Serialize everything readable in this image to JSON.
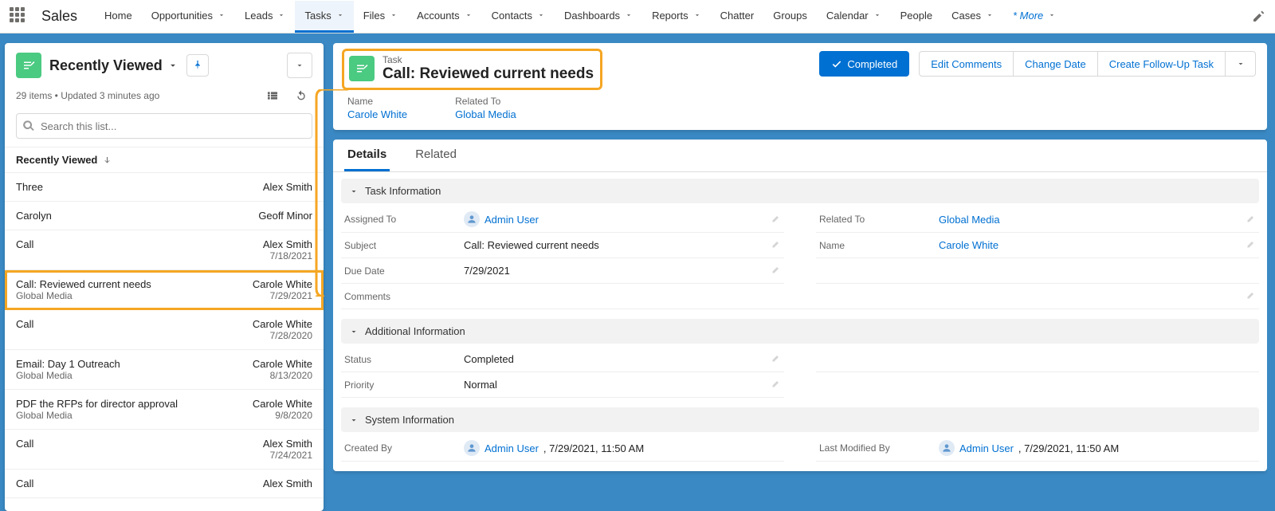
{
  "app": {
    "name": "Sales"
  },
  "nav": {
    "items": [
      "Home",
      "Opportunities",
      "Leads",
      "Tasks",
      "Files",
      "Accounts",
      "Contacts",
      "Dashboards",
      "Reports",
      "Chatter",
      "Groups",
      "Calendar",
      "People",
      "Cases"
    ],
    "more_label": "* More",
    "active": "Tasks",
    "no_caret": [
      "Home",
      "Chatter",
      "Groups",
      "People"
    ]
  },
  "list": {
    "title": "Recently Viewed",
    "meta": "29 items • Updated 3 minutes ago",
    "search_placeholder": "Search this list...",
    "sort_label": "Recently Viewed",
    "rows": [
      {
        "subject": "Three",
        "who": "Alex Smith",
        "related": "",
        "date": ""
      },
      {
        "subject": "Carolyn",
        "who": "Geoff Minor",
        "related": "",
        "date": ""
      },
      {
        "subject": "Call",
        "who": "Alex Smith",
        "related": "",
        "date": "7/18/2021"
      },
      {
        "subject": "Call: Reviewed current needs",
        "who": "Carole White",
        "related": "Global Media",
        "date": "7/29/2021",
        "selected": true
      },
      {
        "subject": "Call",
        "who": "Carole White",
        "related": "",
        "date": "7/28/2020"
      },
      {
        "subject": "Email: Day 1 Outreach",
        "who": "Carole White",
        "related": "Global Media",
        "date": "8/13/2020"
      },
      {
        "subject": "PDF the RFPs for director approval",
        "who": "Carole White",
        "related": "Global Media",
        "date": "9/8/2020"
      },
      {
        "subject": "Call",
        "who": "Alex Smith",
        "related": "",
        "date": "7/24/2021"
      },
      {
        "subject": "Call",
        "who": "Alex Smith",
        "related": "",
        "date": ""
      }
    ]
  },
  "record": {
    "type": "Task",
    "title": "Call: Reviewed current needs",
    "actions": {
      "completed": "Completed",
      "edit_comments": "Edit Comments",
      "change_date": "Change Date",
      "followup": "Create Follow-Up Task"
    },
    "header_fields": {
      "name_label": "Name",
      "name": "Carole White",
      "related_label": "Related To",
      "related": "Global Media"
    },
    "tabs": {
      "details": "Details",
      "related": "Related"
    },
    "sections": {
      "task_info": "Task Information",
      "addl_info": "Additional Information",
      "sys_info": "System Information"
    },
    "fields": {
      "assigned_to_label": "Assigned To",
      "assigned_to": "Admin User",
      "related_to_label": "Related To",
      "related_to": "Global Media",
      "subject_label": "Subject",
      "subject": "Call: Reviewed current needs",
      "name_label": "Name",
      "name": "Carole White",
      "due_label": "Due Date",
      "due": "7/29/2021",
      "comments_label": "Comments",
      "comments": "",
      "status_label": "Status",
      "status": "Completed",
      "priority_label": "Priority",
      "priority": "Normal",
      "created_label": "Created By",
      "created_user": "Admin User",
      "created_ts": ", 7/29/2021, 11:50 AM",
      "modified_label": "Last Modified By",
      "modified_user": "Admin User",
      "modified_ts": ", 7/29/2021, 11:50 AM"
    }
  }
}
